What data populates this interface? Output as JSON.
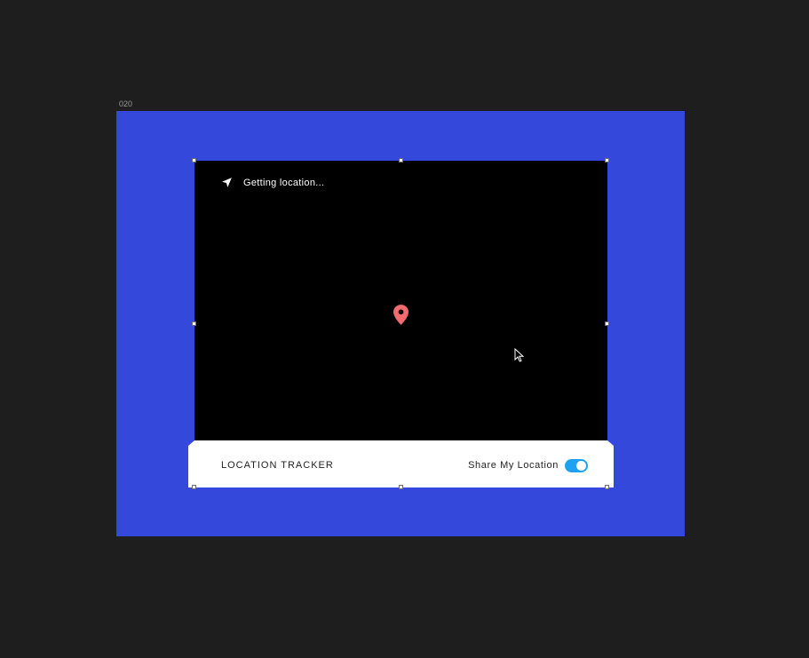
{
  "artboard": {
    "label": "020",
    "background": "#3548dc"
  },
  "map": {
    "background": "#000000",
    "status_icon": "navigation-arrow-icon",
    "status_text": "Getting location...",
    "pin_icon": "map-pin-icon",
    "pin_color": "#f26b6f"
  },
  "toolbar": {
    "title": "LOCATION TRACKER",
    "share_label": "Share My Location",
    "share_enabled": true,
    "toggle_color": "#1da1f2"
  }
}
